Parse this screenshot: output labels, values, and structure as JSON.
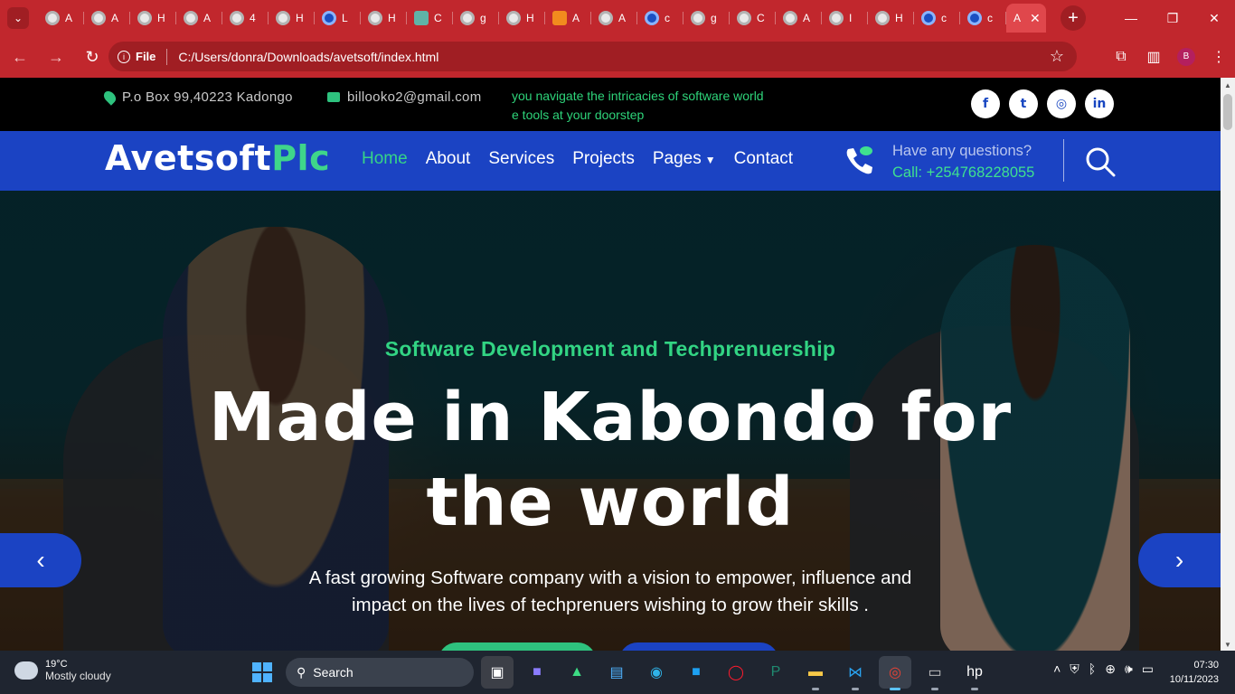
{
  "browser": {
    "tabs": [
      "A",
      "A",
      "H",
      "A",
      "4",
      "H",
      "L",
      "H",
      "C",
      "g",
      "H",
      "A",
      "A",
      "c",
      "g",
      "C",
      "A",
      "I",
      "H",
      "c",
      "c"
    ],
    "active_tab": "A",
    "file_label": "File",
    "url": "C:/Users/donra/Downloads/avetsoft/index.html",
    "profile_initial": "B"
  },
  "topbar": {
    "address": "P.o Box 99,40223 Kadongo",
    "email": "billooko2@gmail.com",
    "marquee_line1": "you navigate the intricacies of software world",
    "marquee_line2": "e tools at your doorstep",
    "social": [
      "f",
      "t",
      "◎",
      "in"
    ]
  },
  "nav": {
    "logo_main": "Avetsoft",
    "logo_accent": "Plc",
    "items": [
      "Home",
      "About",
      "Services",
      "Projects",
      "Pages",
      "Contact"
    ],
    "question": "Have any questions?",
    "call": "Call: +254768228055"
  },
  "hero": {
    "eyebrow": "Software Development and Techprenuership",
    "headline_line1": "Made in Kabondo for",
    "headline_line2": "the world",
    "desc_line1": "A fast growing Software company with a vision to empower, influence and",
    "desc_line2": "impact on the lives of techprenuers wishing to grow their skills ."
  },
  "taskbar": {
    "weather_temp": "19°C",
    "weather_desc": "Mostly cloudy",
    "search_placeholder": "Search",
    "time": "07:30",
    "date": "10/11/2023"
  },
  "colors": {
    "browser_red": "#c1272d",
    "brand_blue": "#1b43c3",
    "brand_green": "#2ec27e"
  }
}
